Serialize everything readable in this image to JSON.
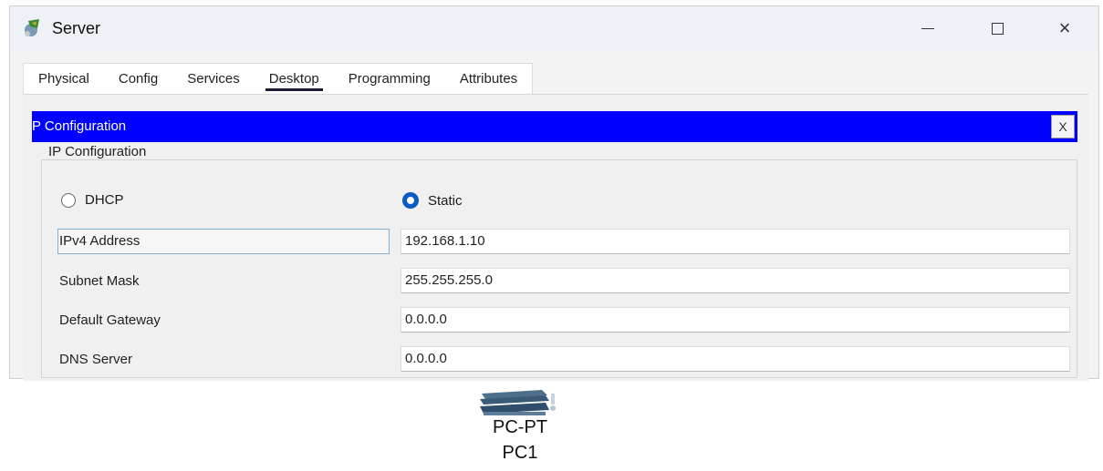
{
  "window": {
    "title": "Server",
    "controls": {
      "minimize": "minimize",
      "maximize": "maximize",
      "close": "×"
    }
  },
  "tabs": [
    {
      "label": "Physical",
      "active": false
    },
    {
      "label": "Config",
      "active": false
    },
    {
      "label": "Services",
      "active": false
    },
    {
      "label": "Desktop",
      "active": true
    },
    {
      "label": "Programming",
      "active": false
    },
    {
      "label": "Attributes",
      "active": false
    }
  ],
  "panel": {
    "header": "P Configuration",
    "close_label": "X",
    "group_title": "IP Configuration",
    "mode": {
      "dhcp_label": "DHCP",
      "static_label": "Static",
      "selected": "Static"
    },
    "fields": [
      {
        "label": "IPv4 Address",
        "value": "192.168.1.10"
      },
      {
        "label": "Subnet Mask",
        "value": "255.255.255.0"
      },
      {
        "label": "Default Gateway",
        "value": "0.0.0.0"
      },
      {
        "label": "DNS Server",
        "value": "0.0.0.0"
      }
    ]
  },
  "device": {
    "type_label": "PC-PT",
    "name_label": "PC1"
  },
  "colors": {
    "header_bg": "#0000ff",
    "radio_selected": "#0a5bc4"
  }
}
